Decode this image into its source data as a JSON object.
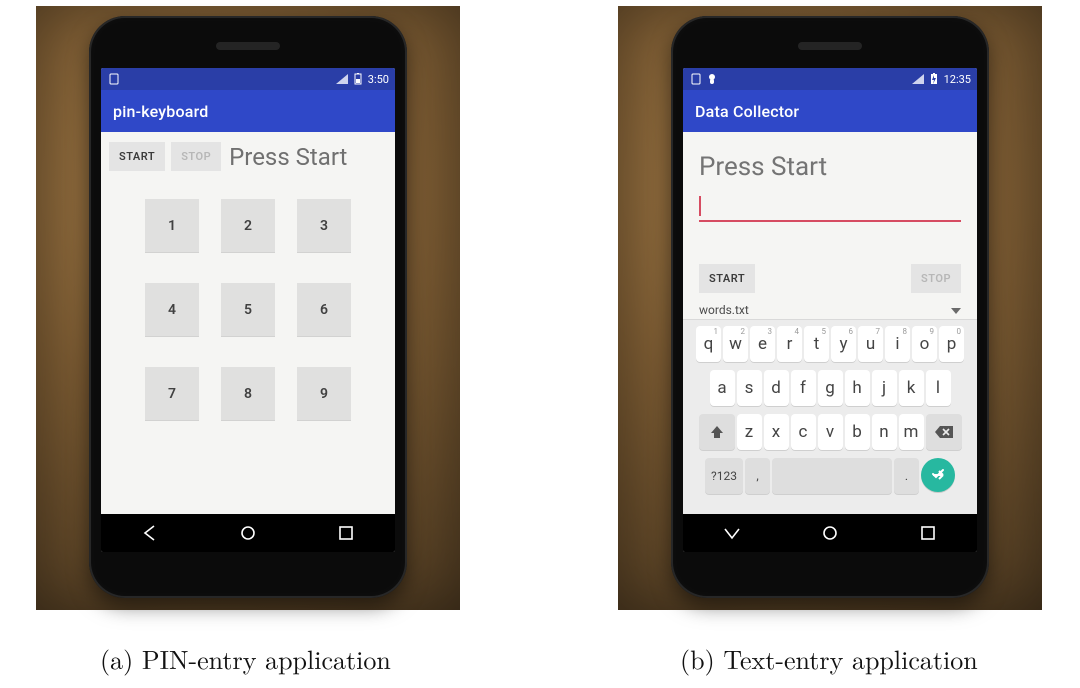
{
  "captions": {
    "a": "(a) PIN-entry application",
    "b": "(b) Text-entry application"
  },
  "phone_a": {
    "status_time": "3:50",
    "app_title": "pin-keyboard",
    "start_label": "START",
    "stop_label": "STOP",
    "prompt": "Press Start",
    "keys": [
      "1",
      "2",
      "3",
      "4",
      "5",
      "6",
      "7",
      "8",
      "9"
    ]
  },
  "phone_b": {
    "status_time": "12:35",
    "app_title": "Data Collector",
    "prompt": "Press Start",
    "start_label": "START",
    "stop_label": "STOP",
    "spinner_value": "words.txt",
    "keyboard": {
      "row1": [
        {
          "k": "q",
          "n": "1"
        },
        {
          "k": "w",
          "n": "2"
        },
        {
          "k": "e",
          "n": "3"
        },
        {
          "k": "r",
          "n": "4"
        },
        {
          "k": "t",
          "n": "5"
        },
        {
          "k": "y",
          "n": "6"
        },
        {
          "k": "u",
          "n": "7"
        },
        {
          "k": "i",
          "n": "8"
        },
        {
          "k": "o",
          "n": "9"
        },
        {
          "k": "p",
          "n": "0"
        }
      ],
      "row2": [
        "a",
        "s",
        "d",
        "f",
        "g",
        "h",
        "j",
        "k",
        "l"
      ],
      "row3": [
        "z",
        "x",
        "c",
        "v",
        "b",
        "n",
        "m"
      ],
      "symkey": "?123",
      "comma": ",",
      "period": "."
    }
  }
}
